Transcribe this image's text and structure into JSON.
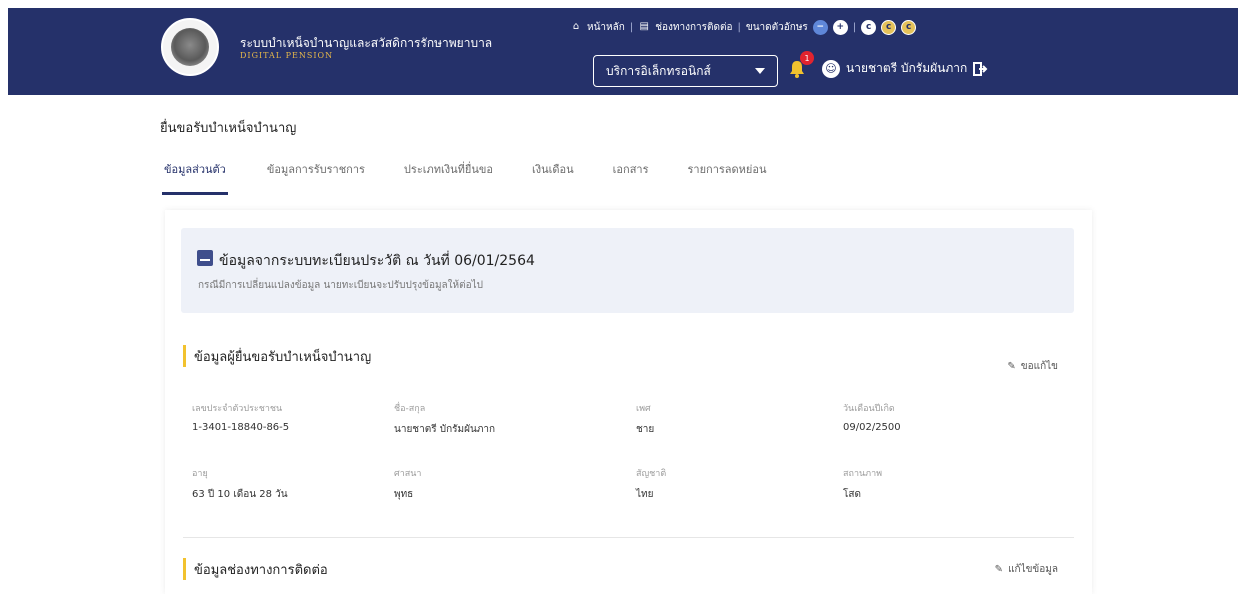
{
  "header": {
    "brand_title": "ระบบบำเหน็จบำนาญและสวัสดิการรักษาพยาบาล",
    "brand_subtitle": "DIGITAL PENSION",
    "topbar": {
      "home_label": "หน้าหลัก",
      "contact_label": "ช่องทางการติดต่อ",
      "font_size_label": "ขนาดตัวอักษร",
      "decrease_font": "−",
      "increase_font": "+",
      "contrast_1": "c",
      "contrast_2": "c",
      "contrast_3": "c"
    },
    "service_select": "บริการอิเล็กทรอนิกส์",
    "notification_count": "1",
    "user_name": "นายชาตรี บักรัมผันภาก"
  },
  "page": {
    "title": "ยื่นขอรับบำเหน็จบำนาญ",
    "tabs": [
      {
        "label": "ข้อมูลส่วนตัว",
        "active": true
      },
      {
        "label": "ข้อมูลการรับราชการ",
        "active": false
      },
      {
        "label": "ประเภทเงินที่ยื่นขอ",
        "active": false
      },
      {
        "label": "เงินเดือน",
        "active": false
      },
      {
        "label": "เอกสาร",
        "active": false
      },
      {
        "label": "รายการลดหย่อน",
        "active": false
      }
    ]
  },
  "info_box": {
    "title": "ข้อมูลจากระบบทะเบียนประวัติ ณ วันที่ 06/01/2564",
    "subtitle": "กรณีมีการเปลี่ยนแปลงข้อมูล นายทะเบียนจะปรับปรุงข้อมูลให้ต่อไป"
  },
  "applicant_section": {
    "title": "ข้อมูลผู้ยื่นขอรับบำเหน็จบำนาญ",
    "action": "ขอแก้ไข",
    "fields": [
      {
        "label": "เลขประจำตัวประชาชน",
        "value": "1-3401-18840-86-5"
      },
      {
        "label": "ชื่อ-สกุล",
        "value": "นายชาตรี บักรัมผันภาก"
      },
      {
        "label": "เพศ",
        "value": "ชาย"
      },
      {
        "label": "วันเดือนปีเกิด",
        "value": "09/02/2500"
      },
      {
        "label": "อายุ",
        "value": "63 ปี 10 เดือน 28 วัน"
      },
      {
        "label": "ศาสนา",
        "value": "พุทธ"
      },
      {
        "label": "สัญชาติ",
        "value": "ไทย"
      },
      {
        "label": "สถานภาพ",
        "value": "โสด"
      }
    ]
  },
  "contact_section": {
    "title": "ข้อมูลช่องทางการติดต่อ",
    "action": "แก้ไขข้อมูล"
  },
  "colors": {
    "header_bg": "#25316a",
    "accent_bar": "#f2c22e",
    "tab_active": "#25316a",
    "badge": "#e2242f"
  }
}
